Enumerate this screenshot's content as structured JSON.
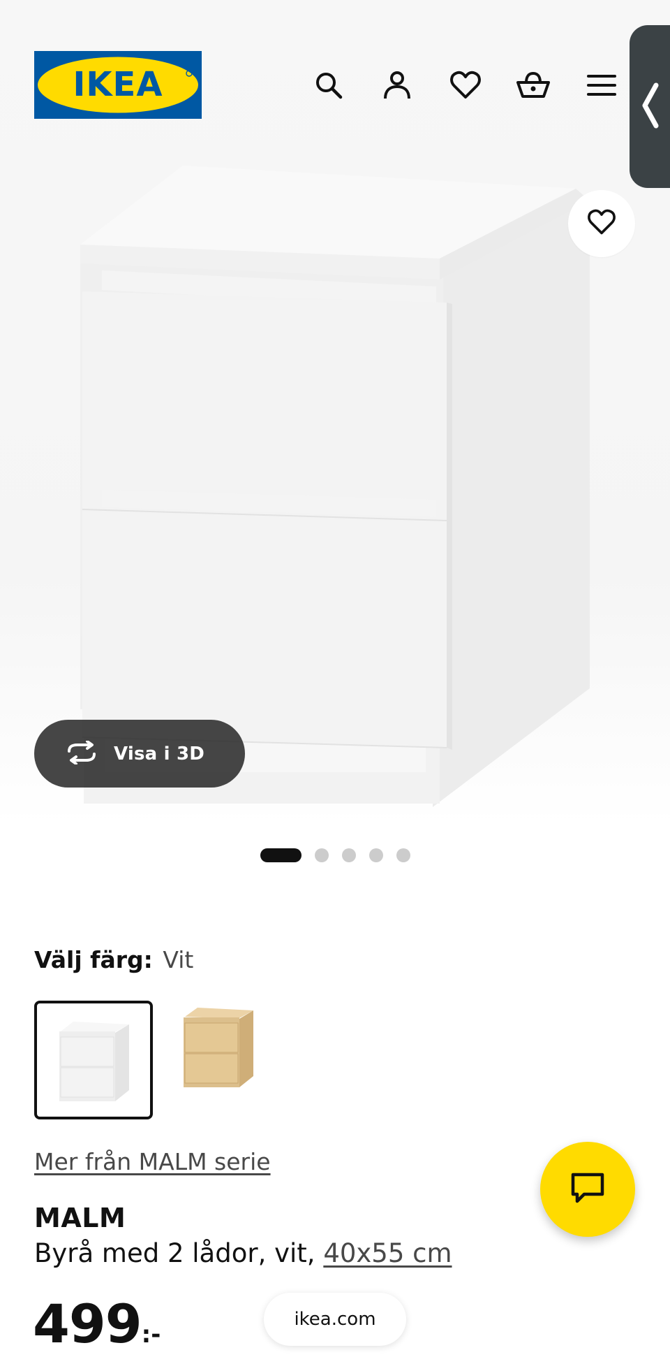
{
  "header": {
    "logo_text": "IKEA",
    "icons": [
      "search-icon",
      "user-icon",
      "heart-icon",
      "basket-icon",
      "menu-icon"
    ]
  },
  "side_tab": {
    "icon": "chevron-left-icon"
  },
  "gallery": {
    "view3d_label": "Visa i 3D",
    "image_count": 5,
    "active_index": 0
  },
  "color": {
    "label": "Välj färg:",
    "value": "Vit",
    "options": [
      "white",
      "birch-veneer"
    ],
    "selected": 0
  },
  "series_link": "Mer från MALM serie",
  "product": {
    "name": "MALM",
    "description": "Byrå med 2 lådor, vit, ",
    "size": "40x55 cm",
    "price_integer": "499",
    "price_suffix": ":-"
  },
  "browser": {
    "url": "ikea.com"
  },
  "colors": {
    "ikea_blue": "#0058a3",
    "ikea_yellow": "#ffdb00",
    "tab_grey": "#3b4245"
  }
}
